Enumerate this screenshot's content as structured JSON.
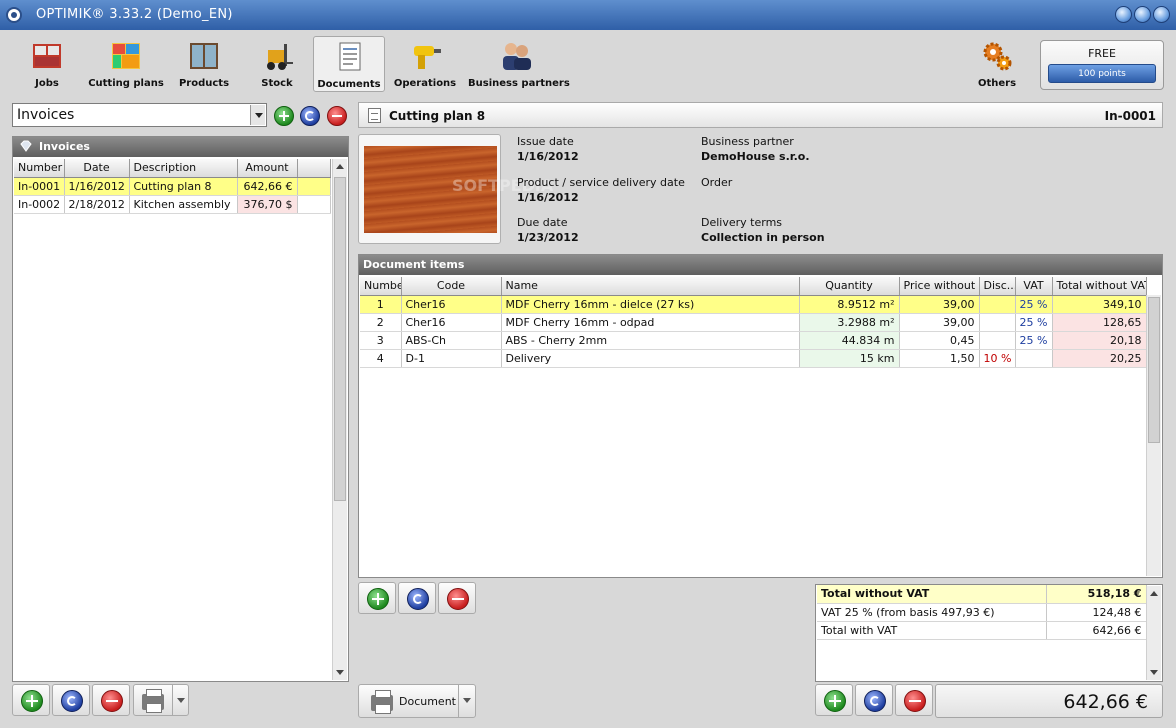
{
  "window": {
    "title": "OPTIMIK® 3.33.2  (Demo_EN)"
  },
  "toolbar": {
    "items": [
      {
        "label": "Jobs",
        "icon": "jobs-icon"
      },
      {
        "label": "Cutting plans",
        "icon": "cutting-plans-icon"
      },
      {
        "label": "Products",
        "icon": "products-icon"
      },
      {
        "label": "Stock",
        "icon": "forklift-icon"
      },
      {
        "label": "Documents",
        "icon": "document-icon"
      },
      {
        "label": "Operations",
        "icon": "drill-icon"
      },
      {
        "label": "Business partners",
        "icon": "partners-icon"
      },
      {
        "label": "Others",
        "icon": "gears-icon"
      }
    ],
    "active": "Documents",
    "license": {
      "label": "FREE",
      "points": "100 points"
    }
  },
  "left": {
    "selector_value": "Invoices",
    "panel_title": "Invoices",
    "columns": [
      "Number",
      "Date",
      "Description",
      "Amount"
    ],
    "rows": [
      {
        "number": "In-0001",
        "date": "1/16/2012",
        "description": "Cutting plan 8",
        "amount": "642,66 €"
      },
      {
        "number": "In-0002",
        "date": "2/18/2012",
        "description": "Kitchen assembly",
        "amount": "376,70 $"
      }
    ]
  },
  "doc": {
    "title": "Cutting plan 8",
    "number": "In-0001",
    "issue_date_label": "Issue date",
    "issue_date": "1/16/2012",
    "delivery_date_label": "Product / service delivery date",
    "delivery_date": "1/16/2012",
    "due_date_label": "Due date",
    "due_date": "1/23/2012",
    "partner_label": "Business partner",
    "partner": "DemoHouse s.r.o.",
    "order_label": "Order",
    "terms_label": "Delivery terms",
    "terms": "Collection in person",
    "watermark": "SOFTPEDIA"
  },
  "items": {
    "panel_title": "Document items",
    "columns": [
      "Number",
      "Code",
      "Name",
      "Quantity",
      "Price without ...",
      "Disc...",
      "VAT",
      "Total without VAT"
    ],
    "rows": [
      {
        "number": "1",
        "code": "Cher16",
        "name": "MDF Cherry 16mm - dielce (27 ks)",
        "quantity": "8.9512 m²",
        "price": "39,00",
        "discount": "",
        "vat": "25 %",
        "total": "349,10"
      },
      {
        "number": "2",
        "code": "Cher16",
        "name": "MDF Cherry 16mm - odpad",
        "quantity": "3.2988 m²",
        "price": "39,00",
        "discount": "",
        "vat": "25 %",
        "total": "128,65"
      },
      {
        "number": "3",
        "code": "ABS-Ch",
        "name": "ABS - Cherry 2mm",
        "quantity": "44.834 m",
        "price": "0,45",
        "discount": "",
        "vat": "25 %",
        "total": "20,18"
      },
      {
        "number": "4",
        "code": "D-1",
        "name": "Delivery",
        "quantity": "15 km",
        "price": "1,50",
        "discount": "10 %",
        "vat": "",
        "total": "20,25"
      }
    ]
  },
  "totals": {
    "rows": [
      {
        "label": "Total without VAT",
        "value": "518,18 €"
      },
      {
        "label": "VAT 25 %  (from basis 497,93 €)",
        "value": "124,48 €"
      },
      {
        "label": "Total with VAT",
        "value": "642,66 €"
      }
    ],
    "grand_total": "642,66 €"
  },
  "bottom": {
    "document_button": "Document"
  }
}
